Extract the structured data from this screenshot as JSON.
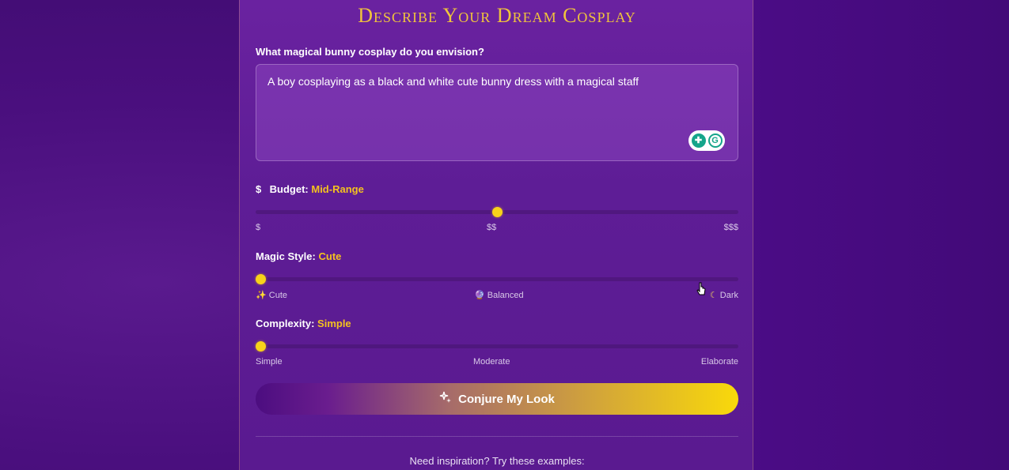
{
  "header": {
    "title": "Describe Your Dream Cosplay"
  },
  "prompt": {
    "label": "What magical bunny cosplay do you envision?",
    "value": "A boy cosplaying as a black and white cute bunny dress with a magical staff"
  },
  "budget": {
    "icon": "dollar-icon",
    "label": "Budget:",
    "value": "Mid-Range",
    "level": 0.5,
    "ticks": [
      "$",
      "$$",
      "$$$"
    ]
  },
  "magic_style": {
    "label": "Magic Style:",
    "value": "Cute",
    "level": 0,
    "ticks": [
      "Cute",
      "Balanced",
      "Dark"
    ],
    "tick_icons": [
      "sparkle-icon",
      "crystal-ball-icon",
      "moon-icon"
    ]
  },
  "complexity": {
    "label": "Complexity:",
    "value": "Simple",
    "level": 0,
    "ticks": [
      "Simple",
      "Moderate",
      "Elaborate"
    ]
  },
  "conjure_button": {
    "label": "Conjure My Look",
    "icon": "wand-sparkle-icon"
  },
  "inspiration": {
    "text": "Need inspiration? Try these examples:"
  },
  "colors": {
    "accent": "#f4c21f",
    "background": "#4a0f7e",
    "panel": "#5e1d96"
  }
}
